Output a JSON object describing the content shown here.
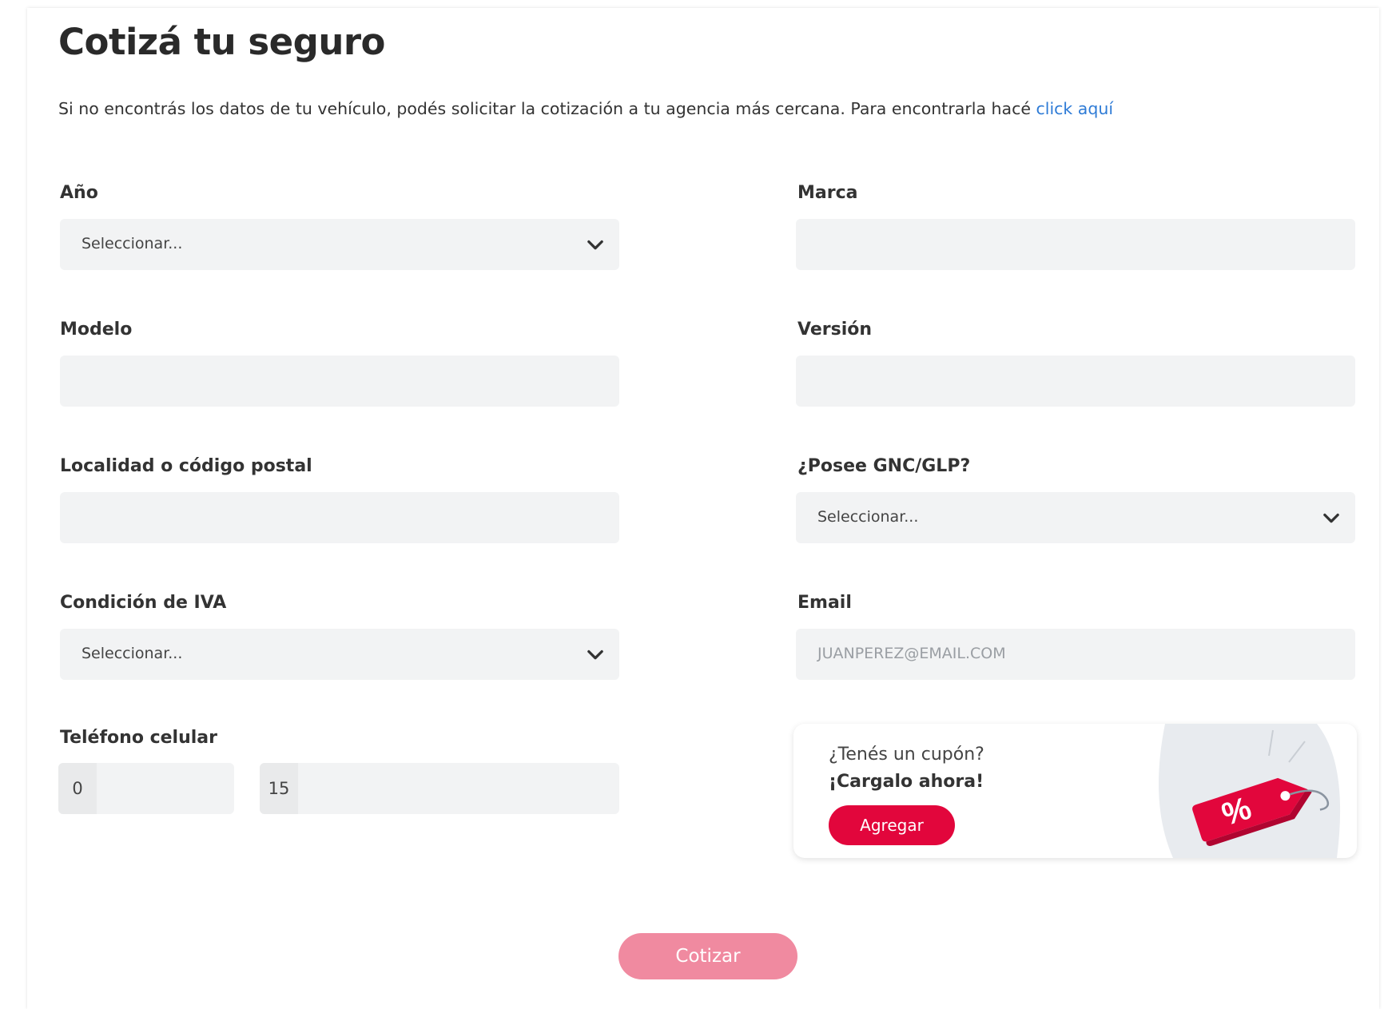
{
  "page": {
    "title": "Cotizá tu seguro",
    "intro_text": "Si no encontrás los datos de tu vehículo, podés solicitar la cotización a tu agencia más cercana. Para encontrarla hacé ",
    "intro_link": "click aquí"
  },
  "form": {
    "anio": {
      "label": "Año",
      "value": "Seleccionar..."
    },
    "marca": {
      "label": "Marca",
      "value": ""
    },
    "modelo": {
      "label": "Modelo",
      "value": ""
    },
    "version": {
      "label": "Versión",
      "value": ""
    },
    "localidad": {
      "label": "Localidad o código postal",
      "value": ""
    },
    "gnc": {
      "label": "¿Posee GNC/GLP?",
      "value": "Seleccionar..."
    },
    "iva": {
      "label": "Condición de IVA",
      "value": "Seleccionar..."
    },
    "email": {
      "label": "Email",
      "placeholder": "JUANPEREZ@EMAIL.COM"
    },
    "telefono": {
      "label": "Teléfono celular",
      "area_prefix": "0",
      "number_prefix": "15"
    }
  },
  "coupon": {
    "question": "¿Tenés un cupón?",
    "cta": "¡Cargalo ahora!",
    "button": "Agregar",
    "tag_symbol": "%"
  },
  "submit_label": "Cotizar",
  "colors": {
    "brand_red": "#e2063c",
    "submit_disabled": "#f08aa0",
    "link_blue": "#2e7bd6",
    "field_bg": "#f2f3f4"
  }
}
